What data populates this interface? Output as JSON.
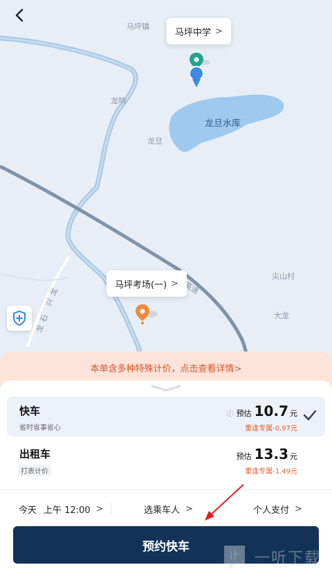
{
  "map": {
    "labels": {
      "mapingzhen": "马坪镇",
      "longxiang": "龙响",
      "longdan": "龙旦",
      "lake": "龙旦水库",
      "jianshancun": "尖山村",
      "dalong": "大龙",
      "highway": "永高速",
      "longxingroad_1": "龙",
      "longxingroad_2": "兴",
      "longxingroad_3": "石",
      "longxingroad_4": "龙"
    },
    "origin_callout": "马坪中学",
    "destination_callout": "马坪考场(一)",
    "chevron": ">"
  },
  "banner": {
    "text": "本单含多种特殊计价，点击查看详情>"
  },
  "options": [
    {
      "title": "快车",
      "subtitle": "省时省事省心",
      "est_label": "预估",
      "price": "10.7",
      "unit": "元",
      "discount": "重逢专属-0.97元",
      "info_icon": "ⓘ"
    },
    {
      "title": "出租车",
      "subtitle": "打表计价",
      "est_label": "预估",
      "price": "13.3",
      "unit": "元",
      "discount": "重逢专属-1.49元"
    }
  ],
  "controls": {
    "time_day": "今天",
    "time_value": "上午 12:00",
    "rider": "选乘车人",
    "payment": "个人支付",
    "chevron": ">"
  },
  "book_button": "预约快车",
  "watermark": {
    "text": "一听下载"
  },
  "colors": {
    "accent": "#123257",
    "origin_pin": "#1fa58c",
    "location_dot": "#3d8be0",
    "destination_pin": "#f08a3a",
    "discount": "#e0622f",
    "banner_text": "#d2582e"
  }
}
